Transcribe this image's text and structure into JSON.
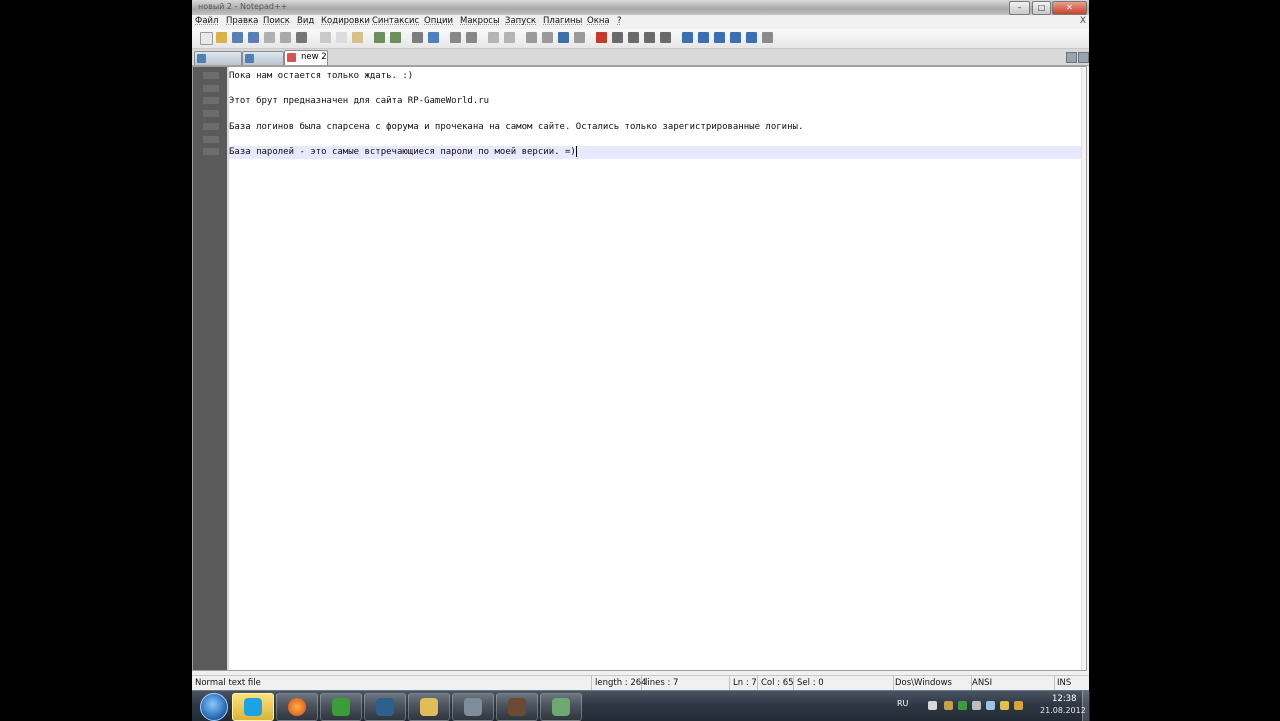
{
  "window": {
    "title": "новый 2 - Notepad++"
  },
  "menu": [
    "Файл",
    "Правка",
    "Поиск",
    "Вид",
    "Кодировки",
    "Синтаксис",
    "Опции",
    "Макросы",
    "Запуск",
    "Плагины",
    "Окна",
    "?"
  ],
  "menu_close": "X",
  "tabs": [
    {
      "label": ""
    },
    {
      "label": ""
    },
    {
      "label": "new 2"
    }
  ],
  "editor": {
    "lines": [
      "Пока нам остается только ждать. :)",
      "",
      "Этот брут предназначен для сайта RP-GameWorld.ru",
      "",
      "База логинов была спарсена с форума и прочекана на самом сайте. Остались только зарегистрированные логины.",
      "",
      "База паролей - это самые встречающиеся пароли по моей версии. =)"
    ]
  },
  "status": {
    "file_type": "Normal text file",
    "length": "length : 264",
    "lines": "lines : 7",
    "ln": "Ln : 7",
    "col": "Col : 65",
    "sel": "Sel : 0",
    "eol": "Dos\\Windows",
    "encoding": "ANSI",
    "mode": "INS"
  },
  "taskbar": {
    "items": [
      "skype",
      "firefox",
      "checkmark",
      "app",
      "folder",
      "display",
      "game",
      "notepad"
    ],
    "language": "RU",
    "time": "12:38",
    "date": "21.08.2012"
  },
  "colors": {
    "accent_tab": "#ffffff",
    "current_line": "#e8e8ff",
    "gutter": "#5a5a5a"
  }
}
